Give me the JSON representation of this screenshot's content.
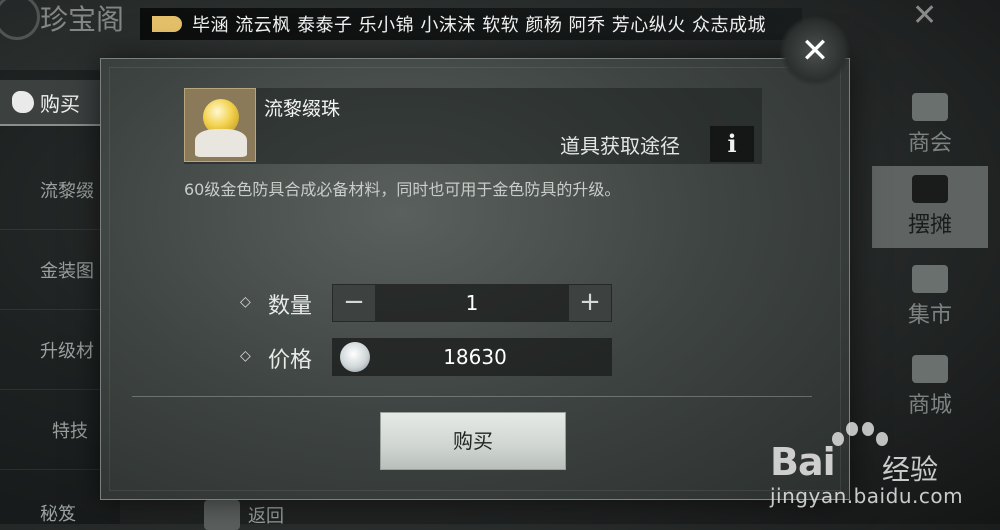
{
  "background": {
    "screen_title": "珍宝阁",
    "left_tab_label": "购买",
    "left_items": [
      "流黎缀",
      "金装图",
      "升级材",
      "特技"
    ],
    "left_bottom_label": "秘笈",
    "back_label": "返回",
    "right_items": [
      {
        "label": "商会",
        "icon": "guild-icon"
      },
      {
        "label": "摆摊",
        "icon": "stall-icon",
        "active": true
      },
      {
        "label": "集市",
        "icon": "market-icon"
      },
      {
        "label": "商城",
        "icon": "mall-icon"
      }
    ]
  },
  "marquee": {
    "names": "毕涵 流云枫 泰泰子 乐小锦 小沫沫 软软 颜杨 阿乔 芳心纵火 众志成城"
  },
  "dialog": {
    "item_name": "流黎缀珠",
    "source_label": "道具获取途径",
    "info_glyph": "i",
    "description": "60级金色防具合成必备材料，同时也可用于金色防具的升级。",
    "quantity_label": "数量",
    "quantity_value": "1",
    "decrement_glyph": "−",
    "increment_glyph": "+",
    "price_label": "价格",
    "price_value": "18630",
    "currency_icon": "silver-ingot-icon",
    "buy_label": "购买",
    "close_glyph": "✕",
    "bullet_glyph": "◇"
  },
  "watermark": {
    "brand": "Bai",
    "brand_suffix": "经验",
    "url": "jingyan.baidu.com"
  },
  "colors": {
    "dialog_bg": "#3e4442",
    "buy_button": "#d6dcd8",
    "orb": "#f2d24e",
    "active_tab_bg": "#5f6462"
  }
}
